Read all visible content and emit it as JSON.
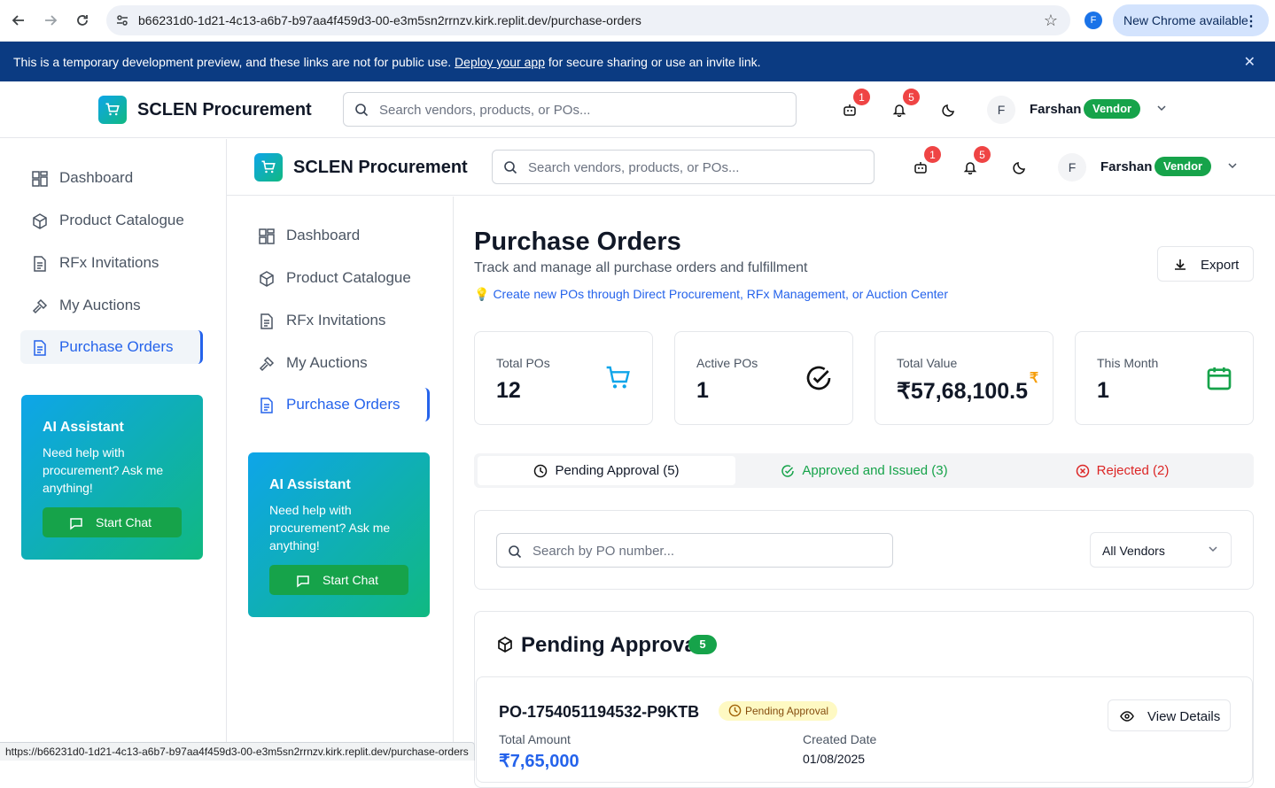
{
  "browser": {
    "url": "b66231d0-1d21-4c13-a6b7-b97aa4f459d3-00-e3m5sn2rrnzv.kirk.replit.dev/purchase-orders",
    "profile_initial": "F",
    "update_label": "New Chrome available",
    "status_url": "https://b66231d0-1d21-4c13-a6b7-b97aa4f459d3-00-e3m5sn2rrnzv.kirk.replit.dev/purchase-orders"
  },
  "banner": {
    "text_before": "This is a temporary development preview, and these links are not for public use.",
    "link": "Deploy your app",
    "text_after": "for secure sharing or use an invite link."
  },
  "header": {
    "brand": "SCLEN Procurement",
    "search_placeholder": "Search vendors, products, or POs...",
    "robot_badge": "1",
    "bell_badge": "5",
    "user_initial": "F",
    "user_name": "Farshan",
    "user_role": "Vendor"
  },
  "sidebar": {
    "items": [
      {
        "label": "Dashboard"
      },
      {
        "label": "Product Catalogue"
      },
      {
        "label": "RFx Invitations"
      },
      {
        "label": "My Auctions"
      },
      {
        "label": "Purchase Orders"
      }
    ],
    "ai": {
      "title": "AI Assistant",
      "description": "Need help with procurement? Ask me anything!",
      "button": "Start Chat"
    }
  },
  "page": {
    "title": "Purchase Orders",
    "subtitle": "Track and manage all purchase orders and fulfillment",
    "hint": "Create new POs through Direct Procurement, RFx Management, or Auction Center",
    "export_label": "Export"
  },
  "stats": [
    {
      "label": "Total POs",
      "value": "12",
      "icon": "cart-icon",
      "color": "#0ea5e9"
    },
    {
      "label": "Active POs",
      "value": "1",
      "icon": "check-circle-icon",
      "color": "#111827"
    },
    {
      "label": "Total Value",
      "value": "₹57,68,100.5",
      "icon": "rupee-icon",
      "color": "#f59e0b"
    },
    {
      "label": "This Month",
      "value": "1",
      "icon": "calendar-icon",
      "color": "#16a34a"
    }
  ],
  "tabs": [
    {
      "label": "Pending Approval (5)",
      "color": "#111827"
    },
    {
      "label": "Approved and Issued (3)",
      "color": "#16a34a"
    },
    {
      "label": "Rejected (2)",
      "color": "#dc2626"
    }
  ],
  "filters": {
    "po_search_placeholder": "Search by PO number...",
    "vendor_select": "All Vendors"
  },
  "pending": {
    "title": "Pending Approval",
    "count": "5",
    "orders": [
      {
        "number": "PO-1754051194532-P9KTB",
        "status": "Pending Approval",
        "view_label": "View Details",
        "amount_label": "Total Amount",
        "amount": "₹7,65,000",
        "created_label": "Created Date",
        "created": "01/08/2025"
      }
    ]
  }
}
